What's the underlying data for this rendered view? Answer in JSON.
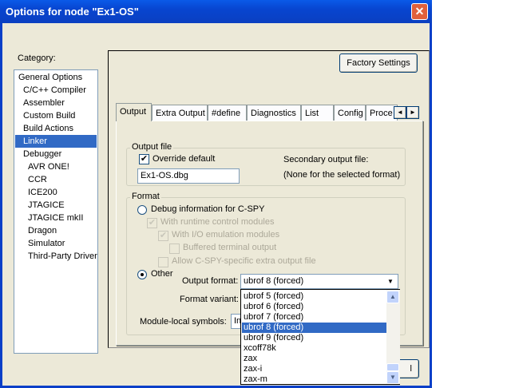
{
  "window": {
    "title": "Options for node \"Ex1-OS\"",
    "close": "✕"
  },
  "category": {
    "label": "Category:",
    "items": [
      "General Options",
      "C/C++ Compiler",
      "Assembler",
      "Custom Build",
      "Build Actions",
      "Linker",
      "Debugger",
      "AVR ONE!",
      "CCR",
      "ICE200",
      "JTAGICE",
      "JTAGICE mkII",
      "Dragon",
      "Simulator",
      "Third-Party Driver"
    ],
    "selected": "Linker"
  },
  "factory_settings": "Factory Settings",
  "tabs": [
    "Output",
    "Extra Output",
    "#define",
    "Diagnostics",
    "List",
    "Config",
    "Proce"
  ],
  "tab_scroll": {
    "left": "◄",
    "right": "►"
  },
  "output_file": {
    "group": "Output file",
    "override_label": "Override default",
    "override_checked": true,
    "filename": "Ex1-OS.dbg",
    "secondary_label": "Secondary output file:",
    "secondary_value": "(None for the selected format)"
  },
  "format": {
    "group": "Format",
    "debug_radio": "Debug information for C-SPY",
    "runtime": "With runtime control modules",
    "io_emul": "With I/O emulation modules",
    "buffered": "Buffered terminal output",
    "allow_cspy": "Allow C-SPY-specific extra output file",
    "other_radio": "Other",
    "output_format_label": "Output format:",
    "output_format_value": "ubrof 8 (forced)",
    "format_variant_label": "Format variant:",
    "module_local_label": "Module-local symbols:",
    "module_local_value": "In"
  },
  "dropdown": {
    "options": [
      "ubrof 5 (forced)",
      "ubrof 6 (forced)",
      "ubrof 7 (forced)",
      "ubrof 8 (forced)",
      "ubrof 9 (forced)",
      "xcoff78k",
      "zax",
      "zax-i",
      "zax-m"
    ],
    "selected": "ubrof 8 (forced)"
  },
  "cancel_fragment": "l"
}
